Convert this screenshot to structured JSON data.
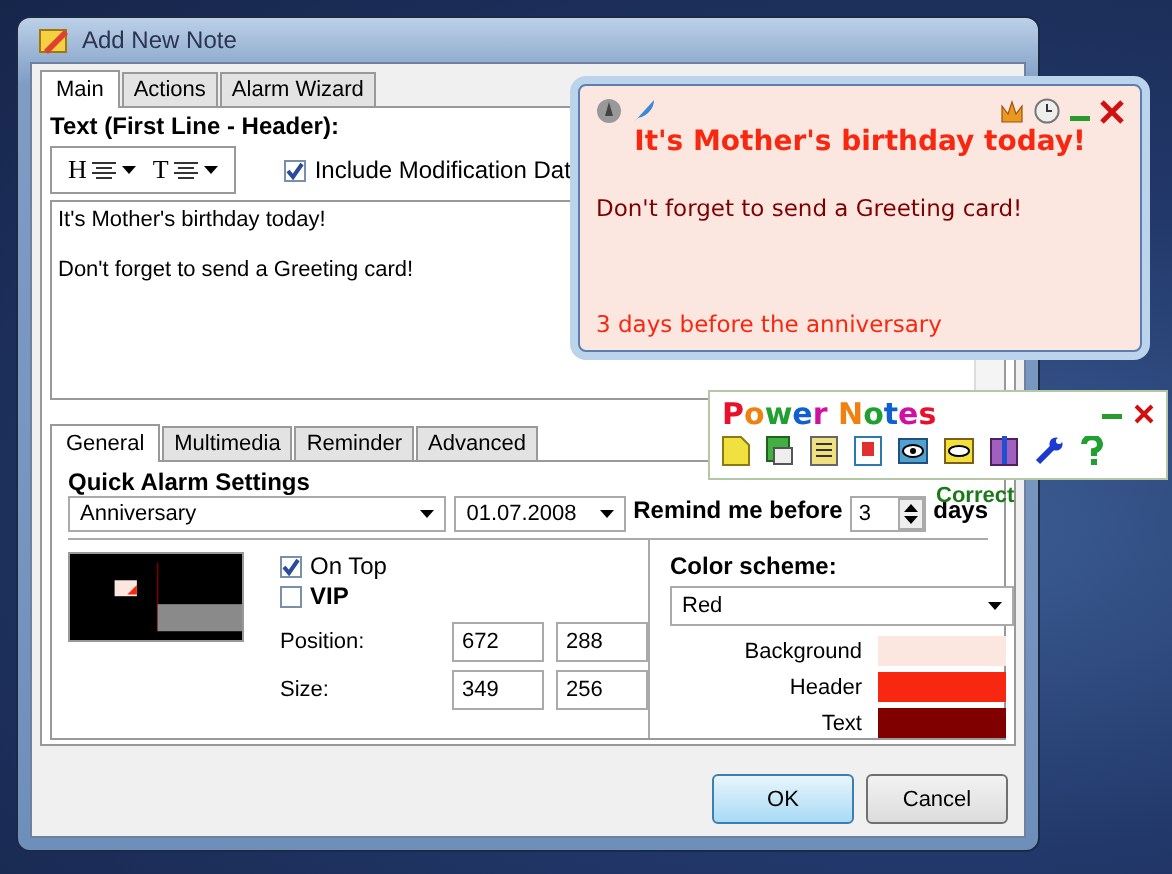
{
  "window": {
    "title": "Add New Note"
  },
  "main_tabs": [
    {
      "label": "Main",
      "selected": true
    },
    {
      "label": "Actions",
      "selected": false
    },
    {
      "label": "Alarm Wizard",
      "selected": false
    }
  ],
  "header_label": "Text (First Line - Header):",
  "format_toolbar": {
    "header_button": "H",
    "text_button": "T"
  },
  "include_date": {
    "label": "Include Modification Dat",
    "checked": true
  },
  "note_lines": [
    "It's Mother's birthday today!",
    "Don't forget to send a Greeting card!"
  ],
  "sub_tabs": [
    {
      "label": "General",
      "selected": true
    },
    {
      "label": "Multimedia",
      "selected": false
    },
    {
      "label": "Reminder",
      "selected": false
    },
    {
      "label": "Advanced",
      "selected": false
    }
  ],
  "quick_alarm": {
    "title": "Quick Alarm Settings",
    "type": "Anniversary",
    "date": "01.07.2008",
    "remind_label": "Remind me before",
    "remind_value": "3",
    "remind_unit": "days",
    "status": "Correct"
  },
  "options": [
    {
      "label": "On Top",
      "checked": true,
      "bold": false
    },
    {
      "label": "VIP",
      "checked": false,
      "bold": true
    }
  ],
  "geometry": [
    {
      "label": "Position:",
      "first": "672",
      "second": "288"
    },
    {
      "label": "Size:",
      "first": "349",
      "second": "256"
    }
  ],
  "color_scheme": {
    "label": "Color scheme:",
    "value": "Red",
    "swatches": [
      {
        "label": "Background",
        "color": "#fce6e0"
      },
      {
        "label": "Header",
        "color": "#f82810"
      },
      {
        "label": "Text",
        "color": "#800000"
      }
    ]
  },
  "buttons": [
    {
      "label": "OK",
      "default": true
    },
    {
      "label": "Cancel",
      "default": false
    }
  ],
  "note_popup": {
    "header": "It's Mother's birthday today!",
    "body": "Don't forget to send a Greeting card!",
    "footer": "3 days before the anniversary"
  },
  "power_notes": {
    "title": "Power Notes"
  }
}
